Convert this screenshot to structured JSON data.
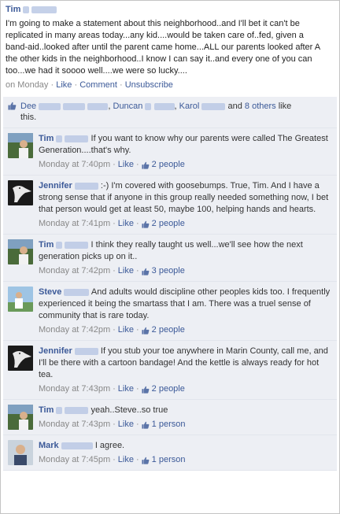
{
  "post": {
    "author_first": "Tim",
    "text_lines": [
      "I'm going to make a statement about this neighborhood..and I'll bet it can't be",
      "replicated in many areas today...any kid....would be taken care of..fed, given a",
      "band-aid..looked after until the parent came home...ALL our parents looked after A",
      "the other kids in the neighborhood..I know I can say it..and every one of you can",
      "too...we had it soooo well....we were so lucky...."
    ],
    "time": "on Monday",
    "like_label": "Like",
    "comment_label": "Comment",
    "unsubscribe_label": "Unsubscribe",
    "separator": "·"
  },
  "likes": {
    "names_prefix": "Dee",
    "name2": "Duncan",
    "name3": "Karol",
    "and_text": "and",
    "others_link": "8 others",
    "suffix": "like",
    "suffix2": "this."
  },
  "comments": [
    {
      "first": "Tim",
      "text": "If you want to know why our parents were called The Greatest Generation....that's why.",
      "time": "Monday at 7:40pm",
      "like_label": "Like",
      "people": "2 people",
      "avatar": "man-outdoors-icon"
    },
    {
      "first": "Jennifer",
      "text": ":-) I'm covered with goosebumps. True, Tim. And I have a strong sense that if anyone in this group really needed something now, I bet that person would get at least 50, maybe 100, helping hands and hearts.",
      "time": "Monday at 7:41pm",
      "like_label": "Like",
      "people": "2 people",
      "avatar": "pelican-icon"
    },
    {
      "first": "Tim",
      "text": "I think they really taught us well...we'll see how the next generation picks up on it..",
      "time": "Monday at 7:42pm",
      "like_label": "Like",
      "people": "3 people",
      "avatar": "man-outdoors-icon"
    },
    {
      "first": "Steve",
      "text": "And adults would discipline other peoples kids too. I frequently experienced it being the smartass that I am. There was a truel sense of community that is rare today.",
      "time": "Monday at 7:42pm",
      "like_label": "Like",
      "people": "2 people",
      "avatar": "man-beach-icon"
    },
    {
      "first": "Jennifer",
      "text": "If you stub your toe anywhere in Marin County, call me, and I'll be there with a cartoon bandage! And the kettle is always ready for hot tea.",
      "time": "Monday at 7:43pm",
      "like_label": "Like",
      "people": "2 people",
      "avatar": "pelican-icon"
    },
    {
      "first": "Tim",
      "text": "yeah..Steve..so true",
      "time": "Monday at 7:43pm",
      "like_label": "Like",
      "people": "1 person",
      "avatar": "man-outdoors-icon"
    },
    {
      "first": "Mark",
      "text": "I agree.",
      "time": "Monday at 7:45pm",
      "like_label": "Like",
      "people": "1 person",
      "avatar": "man-portrait-icon"
    }
  ],
  "colors": {
    "link": "#3b5998",
    "comment_bg": "#edeff4",
    "meta": "#888888"
  }
}
